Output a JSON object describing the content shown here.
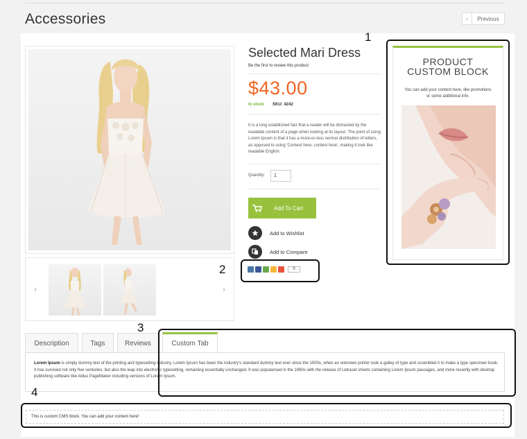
{
  "header": {
    "category_title": "Accessories",
    "previous_label": "Previous"
  },
  "product": {
    "name": "Selected Mari Dress",
    "review_link": "Be the first to review this product",
    "price": "$43.00",
    "stock": "In stock",
    "sku_label": "SKU:",
    "sku_value": "4242",
    "description": "It is a long established fact that a reader will be distracted by the readable content of a page when looking at its layout. The point of using Lorem Ipsum is that it has a more-or-less normal distribution of letters, as opposed to using 'Content here, content here', making it look like readable English.",
    "quantity_label": "Quantity:",
    "quantity_value": "1",
    "add_to_cart": "Add To Cart",
    "wishlist": "Add to Wishlist",
    "compare": "Add to Compare",
    "share_count": "0"
  },
  "custom_block": {
    "title_line1": "PRODUCT",
    "title_line2": "CUSTOM BLOCK",
    "text": "You can add your content here, like promotions or some additional info."
  },
  "tabs": {
    "description": "Description",
    "tags": "Tags",
    "reviews": "Reviews",
    "custom": "Custom Tab",
    "active": "Custom Tab",
    "content_bold": "Lorem Ipsum",
    "content_rest": " is simply dummy text of the printing and typesetting industry. Lorem Ipsum has been the industry's standard dummy text ever since the 1500s, when an unknown printer took a galley of type and scrambled it to make a type specimen book. It has survived not only five centuries, but also the leap into electronic typesetting, remaining essentially unchanged. It was popularised in the 1960s with the release of Letraset sheets containing Lorem Ipsum passages, and more recently with desktop publishing software like Aldus PageMaker including versions of Lorem Ipsum."
  },
  "cms_block": {
    "text": "This is custom CMS block. You can add your content here!"
  },
  "callouts": {
    "n1": "1",
    "n2": "2",
    "n3": "3",
    "n4": "4"
  },
  "colors": {
    "accent_green": "#98c23d",
    "price_orange": "#f26522",
    "stock_green": "#7ab23c"
  }
}
